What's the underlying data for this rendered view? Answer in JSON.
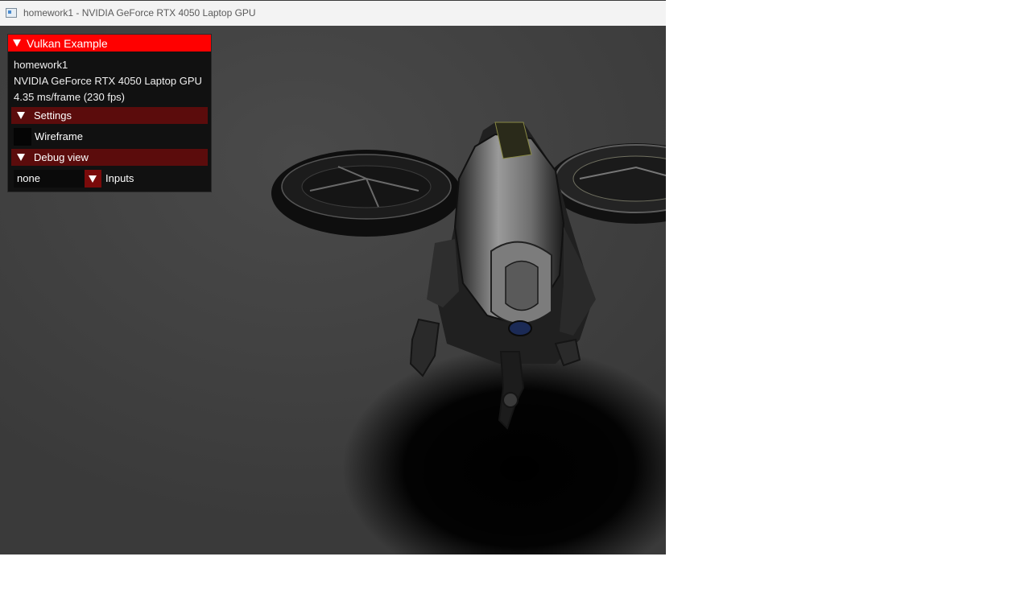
{
  "window": {
    "title": "homework1 - NVIDIA GeForce RTX 4050 Laptop GPU"
  },
  "panel": {
    "header": "Vulkan Example",
    "app_name": "homework1",
    "gpu": "NVIDIA GeForce RTX 4050 Laptop GPU",
    "frame_time": "4.35 ms/frame (230 fps)",
    "settings_label": "Settings",
    "wireframe_label": "Wireframe",
    "wireframe_checked": false,
    "debug_label": "Debug view",
    "debug_value": "none",
    "debug_combo_label": "Inputs"
  },
  "colors": {
    "header": "#ff0000",
    "section": "#5b0c0c",
    "background": "#444444"
  },
  "icons": {
    "app": "window-app-icon",
    "collapse": "triangle-down-icon"
  }
}
